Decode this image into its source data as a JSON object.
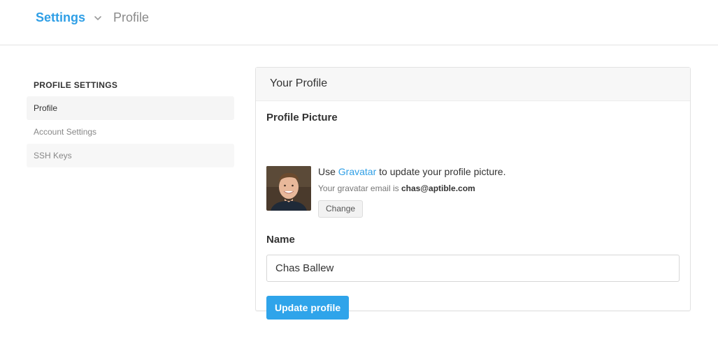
{
  "breadcrumb": {
    "settings_label": "Settings",
    "chevron_icon": "chevron-down-icon",
    "current_label": "Profile"
  },
  "sidebar": {
    "heading": "PROFILE SETTINGS",
    "items": [
      {
        "label": "Profile",
        "active": true
      },
      {
        "label": "Account Settings",
        "active": false
      },
      {
        "label": "SSH Keys",
        "active": false
      }
    ]
  },
  "panel": {
    "title": "Your Profile",
    "picture": {
      "title": "Profile Picture",
      "use_prefix": "Use",
      "gravatar_link": "Gravatar",
      "use_suffix": "to update your profile picture.",
      "email_prefix": "Your gravatar email is",
      "email": "chas@aptible.com",
      "change_label": "Change"
    },
    "name": {
      "title": "Name",
      "value": "Chas Ballew"
    },
    "update_label": "Update profile"
  },
  "colors": {
    "accent": "#2f9fe6",
    "button": "#2fa4ea"
  }
}
